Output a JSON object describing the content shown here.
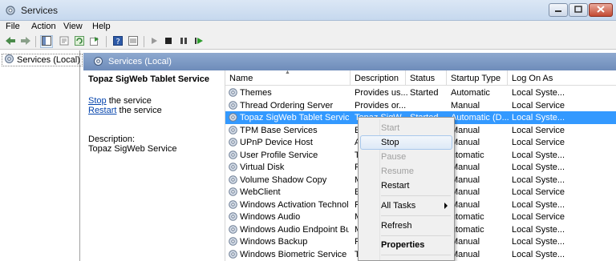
{
  "window": {
    "title": "Services"
  },
  "menu": [
    "File",
    "Action",
    "View",
    "Help"
  ],
  "tree": {
    "root_label": "Services (Local)"
  },
  "content": {
    "header_title": "Services (Local)"
  },
  "detail": {
    "service_name": "Topaz SigWeb Tablet Service",
    "stop_link": "Stop",
    "stop_suffix": " the service",
    "restart_link": "Restart",
    "restart_suffix": " the service",
    "description_label": "Description:",
    "description_text": "Topaz SigWeb Service"
  },
  "table": {
    "columns": [
      "Name",
      "Description",
      "Status",
      "Startup Type",
      "Log On As"
    ],
    "rows": [
      {
        "name": "Themes",
        "description": "Provides us...",
        "status": "Started",
        "startup": "Automatic",
        "logon": "Local Syste..."
      },
      {
        "name": "Thread Ordering Server",
        "description": "Provides or...",
        "status": "",
        "startup": "Manual",
        "logon": "Local Service"
      },
      {
        "name": "Topaz SigWeb Tablet Service",
        "description": "Topaz SigW...",
        "status": "Started",
        "startup": "Automatic (D...",
        "logon": "Local Syste..."
      },
      {
        "name": "TPM Base Services",
        "description": "E",
        "status": "",
        "startup": "Manual",
        "logon": "Local Service"
      },
      {
        "name": "UPnP Device Host",
        "description": "A",
        "status": "",
        "startup": "Manual",
        "logon": "Local Service"
      },
      {
        "name": "User Profile Service",
        "description": "T",
        "status": "",
        "startup": "utomatic",
        "logon": "Local Syste..."
      },
      {
        "name": "Virtual Disk",
        "description": "P",
        "status": "",
        "startup": "Manual",
        "logon": "Local Syste..."
      },
      {
        "name": "Volume Shadow Copy",
        "description": "M",
        "status": "",
        "startup": "Manual",
        "logon": "Local Syste..."
      },
      {
        "name": "WebClient",
        "description": "E",
        "status": "",
        "startup": "Manual",
        "logon": "Local Service"
      },
      {
        "name": "Windows Activation Technolo...",
        "description": "P",
        "status": "",
        "startup": "Manual",
        "logon": "Local Syste..."
      },
      {
        "name": "Windows Audio",
        "description": "M",
        "status": "",
        "startup": "utomatic",
        "logon": "Local Service"
      },
      {
        "name": "Windows Audio Endpoint Buil...",
        "description": "M",
        "status": "",
        "startup": "utomatic",
        "logon": "Local Syste..."
      },
      {
        "name": "Windows Backup",
        "description": "P",
        "status": "",
        "startup": "Manual",
        "logon": "Local Syste..."
      },
      {
        "name": "Windows Biometric Service",
        "description": "T",
        "status": "",
        "startup": "Manual",
        "logon": "Local Syste..."
      }
    ]
  },
  "context_menu": {
    "items": [
      {
        "label": "Start",
        "enabled": false
      },
      {
        "label": "Stop",
        "enabled": true,
        "highlighted": true
      },
      {
        "label": "Pause",
        "enabled": false
      },
      {
        "label": "Resume",
        "enabled": false
      },
      {
        "label": "Restart",
        "enabled": true
      },
      {
        "label": "All Tasks",
        "enabled": true,
        "submenu": true
      },
      {
        "label": "Refresh",
        "enabled": true
      },
      {
        "label": "Properties",
        "enabled": true,
        "bold": true
      }
    ]
  },
  "colors": {
    "selection": "#3399ff",
    "header_band": "#7f9bc6",
    "link": "#0645ad"
  },
  "icons": [
    "services-gear-icon",
    "back-arrow-icon",
    "forward-arrow-icon",
    "console-tree-icon",
    "properties-icon",
    "refresh-icon",
    "export-icon",
    "help-icon",
    "play-icon",
    "stop-icon",
    "pause-icon",
    "restart-icon",
    "minimize-icon",
    "maximize-icon",
    "close-icon"
  ]
}
